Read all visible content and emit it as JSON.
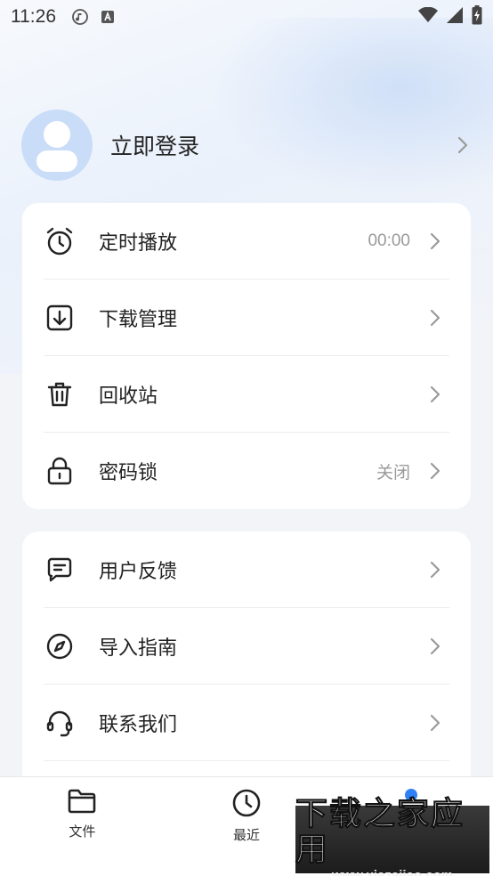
{
  "status_bar": {
    "time": "11:26",
    "icons": [
      "music-icon",
      "a-icon",
      "wifi-icon",
      "signal-icon",
      "battery-icon"
    ]
  },
  "profile": {
    "login_label": "立即登录"
  },
  "menu_group_1": [
    {
      "icon": "alarm-clock-icon",
      "label": "定时播放",
      "value": "00:00"
    },
    {
      "icon": "download-icon",
      "label": "下载管理",
      "value": ""
    },
    {
      "icon": "trash-icon",
      "label": "回收站",
      "value": ""
    },
    {
      "icon": "lock-icon",
      "label": "密码锁",
      "value": "关闭"
    }
  ],
  "menu_group_2": [
    {
      "icon": "feedback-icon",
      "label": "用户反馈",
      "value": ""
    },
    {
      "icon": "compass-icon",
      "label": "导入指南",
      "value": ""
    },
    {
      "icon": "headset-icon",
      "label": "联系我们",
      "value": ""
    }
  ],
  "tabbar": {
    "tabs": [
      {
        "icon": "folder-icon",
        "label": "文件",
        "active": false
      },
      {
        "icon": "clock-icon",
        "label": "最近",
        "active": false
      },
      {
        "icon": "user-icon",
        "label": "",
        "active": true
      }
    ],
    "active_color": "#2f7ff5"
  },
  "watermark": {
    "title": "下载之家应用",
    "url": "www.xiazaiiao.com"
  }
}
